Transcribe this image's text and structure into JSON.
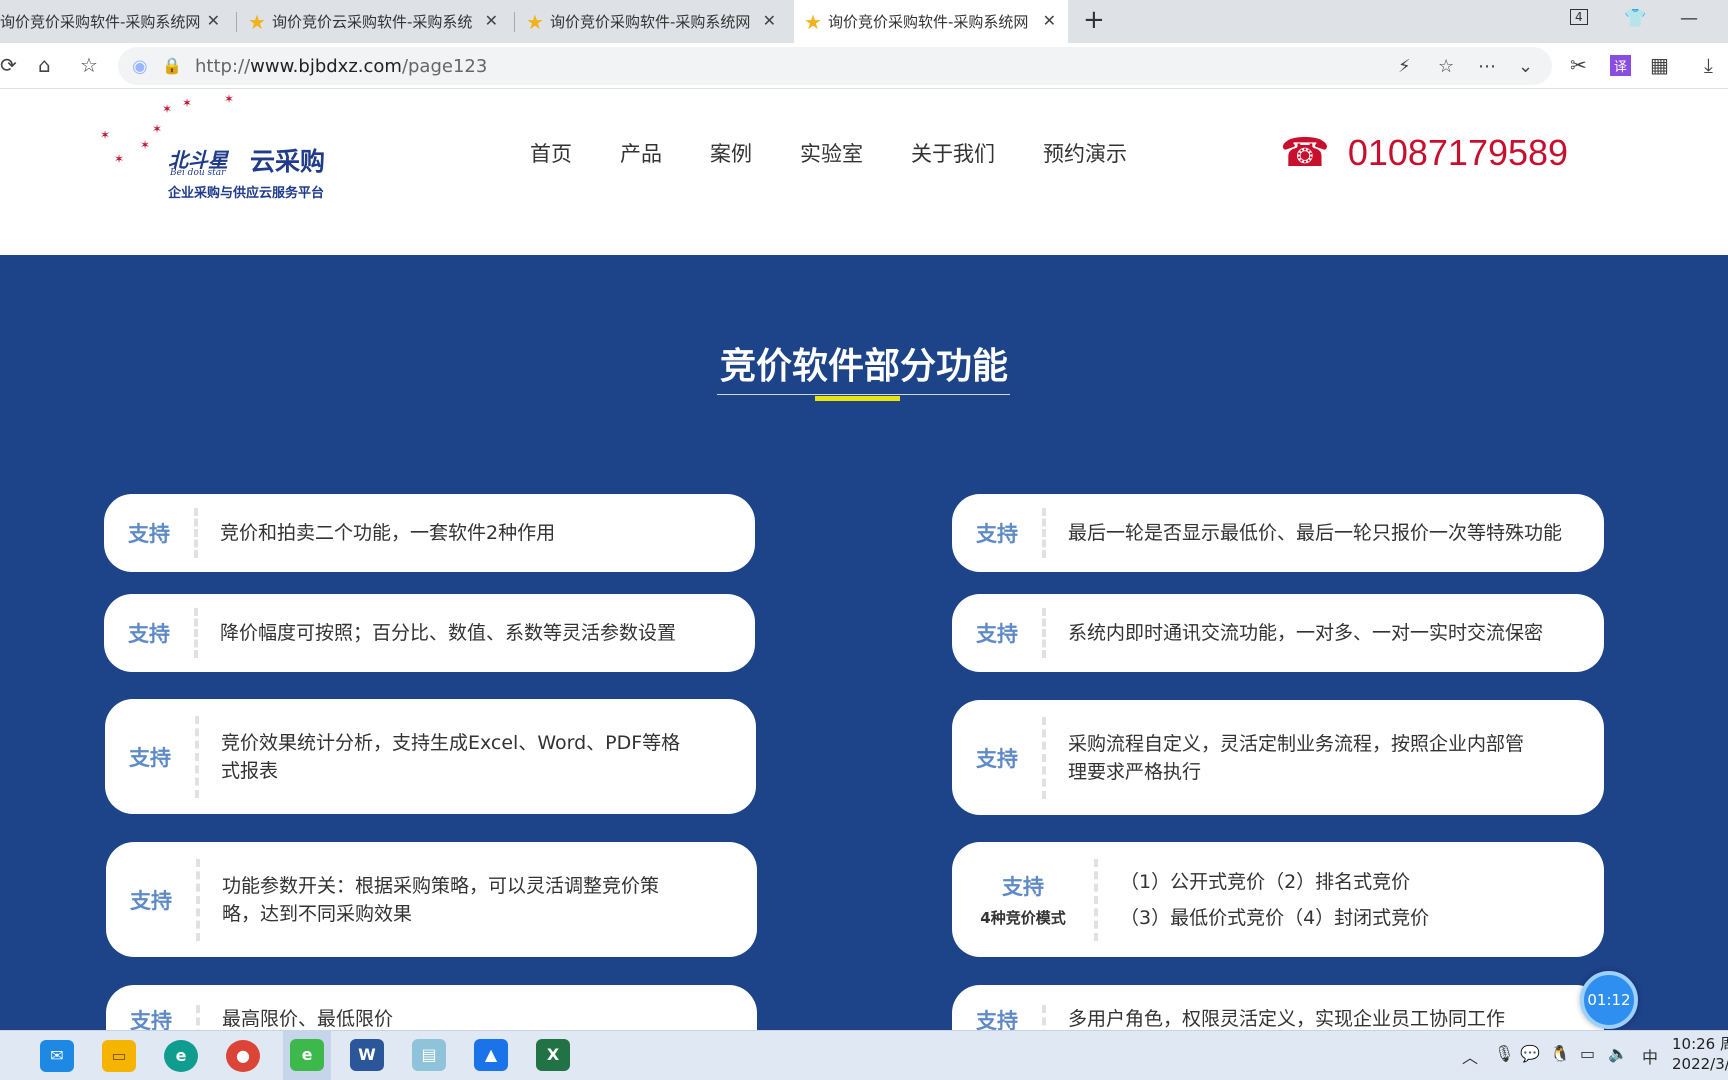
{
  "browser": {
    "tabs": [
      {
        "title": "询价竞价采购软件-采购系统网",
        "active": false
      },
      {
        "title": "询价竞价云采购软件-采购系统",
        "active": false
      },
      {
        "title": "询价竞价采购软件-采购系统网",
        "active": false
      },
      {
        "title": "询价竞价采购软件-采购系统网",
        "active": true
      }
    ],
    "tab_counter": "4",
    "url_prefix": "http://",
    "url_domain": "www.bjbdxz.com",
    "url_path": "/page123"
  },
  "site": {
    "logo": {
      "script_text": "北斗星",
      "brand": "云采购",
      "romanized": "Bei dou star",
      "slogan": "企业采购与供应云服务平台"
    },
    "nav": [
      "首页",
      "产品",
      "案例",
      "实验室",
      "关于我们",
      "预约演示"
    ],
    "phone": "01087179589"
  },
  "features": {
    "title": "竞价软件部分功能",
    "tag": "支持",
    "left": [
      {
        "lines": [
          "竞价和拍卖二个功能，一套软件2种作用"
        ]
      },
      {
        "lines": [
          "降价幅度可按照；百分比、数值、系数等灵活参数设置"
        ]
      },
      {
        "lines": [
          "竞价效果统计分析，支持生成Excel、Word、PDF等格",
          "式报表"
        ]
      },
      {
        "lines": [
          "功能参数开关：根据采购策略，可以灵活调整竞价策",
          "略，达到不同采购效果"
        ]
      },
      {
        "lines": [
          "最高限价、最低限价"
        ]
      }
    ],
    "right": [
      {
        "lines": [
          "最后一轮是否显示最低价、最后一轮只报价一次等特殊功能"
        ]
      },
      {
        "lines": [
          "系统内即时通讯交流功能，一对多、一对一实时交流保密"
        ]
      },
      {
        "lines": [
          "采购流程自定义，灵活定制业务流程，按照企业内部管",
          "理要求严格执行"
        ]
      },
      {
        "sub": "4种竞价模式",
        "lines": [
          "（1）公开式竞价（2）排名式竞价",
          "（3）最低价式竞价（4）封闭式竞价"
        ]
      },
      {
        "lines": [
          "多用户角色，权限灵活定义，实现企业员工协同工作"
        ]
      }
    ]
  },
  "timer": "01:12",
  "taskbar": {
    "time": "10:26 周",
    "date": "2022/3/",
    "ime": "中"
  }
}
